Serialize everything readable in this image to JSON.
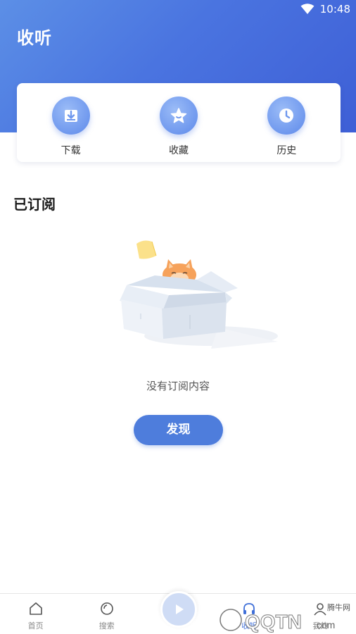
{
  "status_bar": {
    "time": "10:48"
  },
  "header": {
    "title": "收听"
  },
  "quick_actions": [
    {
      "label": "下载",
      "icon": "download-icon"
    },
    {
      "label": "收藏",
      "icon": "star-icon"
    },
    {
      "label": "历史",
      "icon": "clock-icon"
    }
  ],
  "subscriptions": {
    "title": "已订阅",
    "empty_text": "没有订阅内容",
    "discover_label": "发现"
  },
  "bottom_nav": [
    {
      "label": "首页",
      "icon": "home-icon"
    },
    {
      "label": "搜索",
      "icon": "search-icon"
    },
    {
      "label": "收听",
      "icon": "headphones-icon",
      "active": true
    },
    {
      "label": "我的",
      "icon": "user-icon"
    }
  ],
  "watermark": {
    "text": "腾牛网",
    "logo": "QQTN"
  },
  "colors": {
    "primary": "#4e7ddc",
    "header_start": "#5c8fe6",
    "header_end": "#3e5fd6"
  }
}
